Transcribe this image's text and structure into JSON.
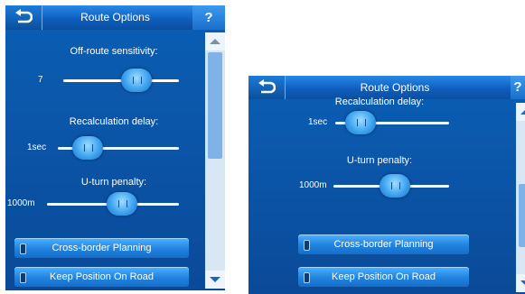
{
  "left_screen": {
    "title": "Route Options",
    "help_label": "?",
    "sensitivity": {
      "label": "Off-route sensitivity:",
      "value": "7"
    },
    "delay": {
      "label": "Recalculation delay:",
      "value": "1sec"
    },
    "uturn": {
      "label": "U-turn penalty:",
      "value": "1000m"
    },
    "buttons": [
      {
        "label": "Cross-border Planning"
      },
      {
        "label": "Keep Position On Road"
      }
    ]
  },
  "right_screen": {
    "title": "Route Options",
    "help_label": "?",
    "delay": {
      "label": "Recalculation delay:",
      "value": "1sec"
    },
    "uturn": {
      "label": "U-turn penalty:",
      "value": "1000m"
    },
    "buttons": [
      {
        "label": "Cross-border Planning"
      },
      {
        "label": "Keep Position On Road"
      }
    ]
  }
}
